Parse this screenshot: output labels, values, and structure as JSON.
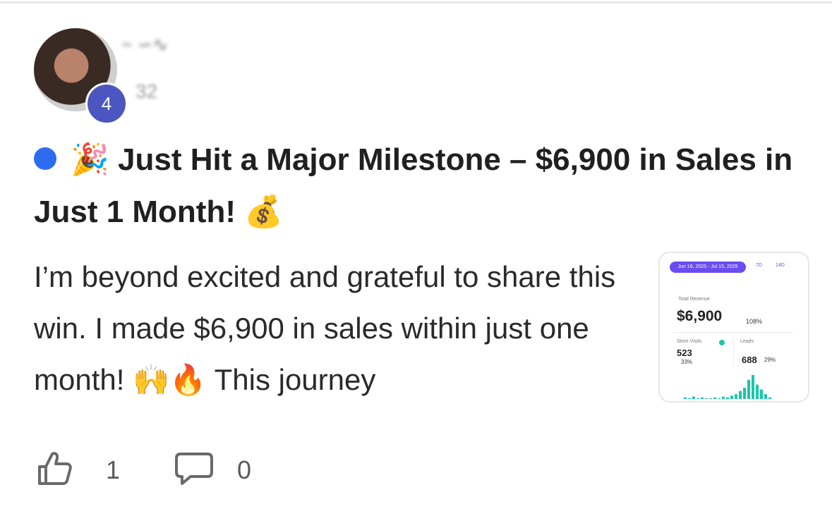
{
  "post": {
    "author": {
      "avatar": "avatar-photo",
      "level": "4",
      "name": "~ ∽∿",
      "meta": "32"
    },
    "title_prefix_icon": "party-popper-emoji",
    "title": "Just Hit a Major Milestone – $6,900 in Sales in Just 1 Month!",
    "title_suffix_icon": "money-bag-emoji",
    "body": "I’m beyond excited and grateful to share this win. I made $6,900 in sales within just one month!",
    "body_emoji": "🙌🔥",
    "body_tail": "This journey",
    "unread_color": "#2d6cf0"
  },
  "thumbnail": {
    "date_range": "Jun 16, 2025 - Jul 15, 2025",
    "tab_1": "7D",
    "tab_2": "14D",
    "revenue_label": "Total Revenue",
    "revenue_value": "$6,900",
    "revenue_change": "108%",
    "store_visits_label": "Store Visits",
    "store_visits_value": "523",
    "store_visits_change": "33%",
    "leads_label": "Leads",
    "leads_value": "688",
    "leads_change": "29%",
    "accent_color": "#6a4cf0",
    "bar_color": "#19c7a8",
    "bars": [
      2,
      1,
      3,
      1,
      2,
      1,
      1,
      2,
      1,
      3,
      2,
      4,
      6,
      10,
      14,
      24,
      30,
      18,
      12,
      6,
      2
    ]
  },
  "actions": {
    "likes": "1",
    "comments": "0",
    "like_icon": "thumbs-up-icon",
    "comment_icon": "comment-bubble-icon"
  }
}
